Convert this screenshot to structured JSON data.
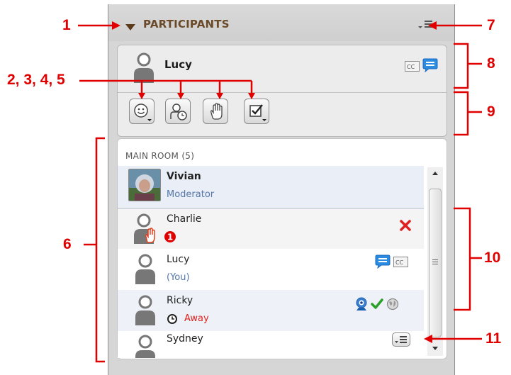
{
  "panel": {
    "title": "PARTICIPANTS"
  },
  "me": {
    "name": "Lucy",
    "status_icons": [
      "cc-icon",
      "chat-icon"
    ]
  },
  "actions": [
    {
      "name": "emoticon-button",
      "icon": "smiley-icon"
    },
    {
      "name": "away-button",
      "icon": "user-clock-icon"
    },
    {
      "name": "raise-hand-button",
      "icon": "hand-icon"
    },
    {
      "name": "poll-answer-button",
      "icon": "checkbox-icon"
    }
  ],
  "room": {
    "title": "MAIN ROOM",
    "count": "(5)"
  },
  "participants": [
    {
      "name": "Vivian",
      "sub": "Moderator"
    },
    {
      "name": "Charlie",
      "badge": "1"
    },
    {
      "name": "Lucy",
      "sub": "(You)"
    },
    {
      "name": "Ricky",
      "sub": "Away"
    },
    {
      "name": "Sydney"
    }
  ],
  "callouts": [
    "1",
    "2, 3, 4, 5",
    "6",
    "7",
    "8",
    "9",
    "10",
    "11"
  ],
  "colors": {
    "callout": "#e00000",
    "moderator": "#5577aa",
    "away": "#e0201a",
    "header_text": "#6b4a2a"
  }
}
